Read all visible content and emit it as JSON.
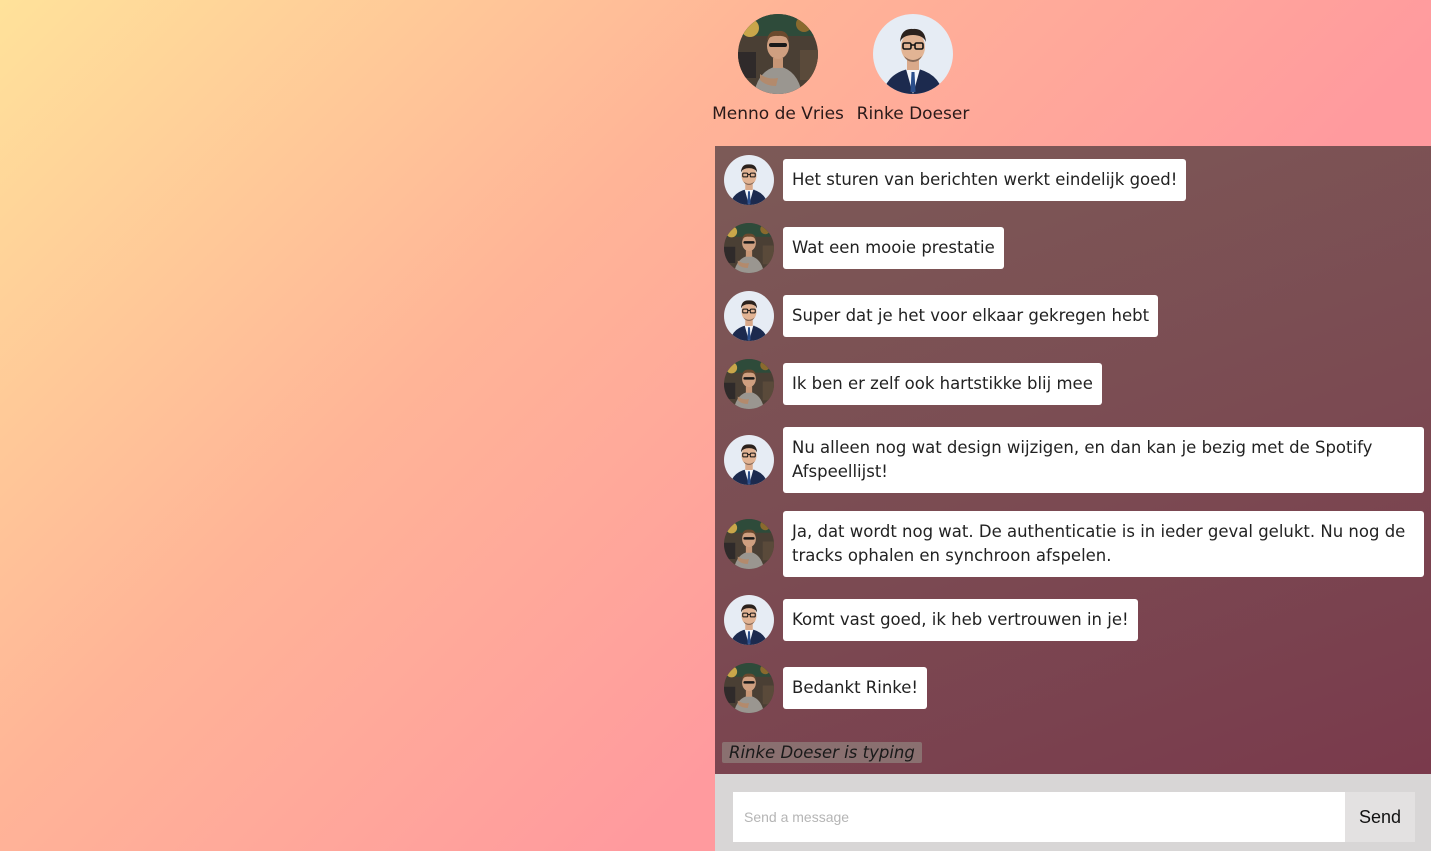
{
  "users": [
    {
      "name": "Menno de Vries",
      "avatar": "avatar-menno"
    },
    {
      "name": "Rinke Doeser",
      "avatar": "avatar-rinke"
    }
  ],
  "messages": [
    {
      "from": "rinke",
      "text": "Het sturen van berichten werkt eindelijk goed!"
    },
    {
      "from": "menno",
      "text": "Wat een mooie prestatie"
    },
    {
      "from": "rinke",
      "text": "Super dat je het voor elkaar gekregen hebt"
    },
    {
      "from": "menno",
      "text": "Ik ben er zelf ook hartstikke blij mee"
    },
    {
      "from": "rinke",
      "text": "Nu alleen nog wat design wijzigen, en dan kan je bezig met de Spotify Afspeellijst!"
    },
    {
      "from": "menno",
      "text": "Ja, dat wordt nog wat. De authenticatie is in ieder geval gelukt. Nu nog de tracks ophalen en synchroon afspelen."
    },
    {
      "from": "rinke",
      "text": "Komt vast goed, ik heb vertrouwen in je!"
    },
    {
      "from": "menno",
      "text": "Bedankt Rinke!"
    }
  ],
  "typing_indicator": "Rinke Doeser is typing",
  "composer": {
    "placeholder": "Send a message",
    "send_label": "Send"
  },
  "colors": {
    "chat_bg": "#7b4a52",
    "composer_bg": "#d8d6d6",
    "bubble_bg": "#ffffff"
  }
}
